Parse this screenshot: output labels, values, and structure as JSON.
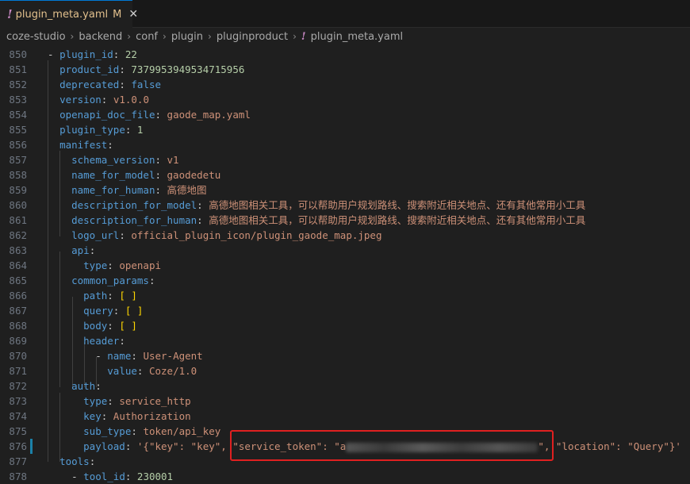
{
  "tab": {
    "icon": "exclamation-icon",
    "excl": "!",
    "filename": "plugin_meta.yaml",
    "modified": "M",
    "close": "✕"
  },
  "breadcrumb": {
    "segments": [
      "coze-studio",
      "backend",
      "conf",
      "plugin",
      "pluginproduct"
    ],
    "file_excl": "!",
    "file": "plugin_meta.yaml"
  },
  "editor": {
    "line_numbers": [
      "850",
      "851",
      "852",
      "853",
      "854",
      "855",
      "856",
      "857",
      "858",
      "859",
      "860",
      "861",
      "862",
      "863",
      "864",
      "865",
      "866",
      "867",
      "868",
      "869",
      "870",
      "871",
      "872",
      "873",
      "874",
      "875",
      "876",
      "877",
      "878"
    ],
    "lines": {
      "l850": {
        "key": "plugin_id",
        "value": "22"
      },
      "l851": {
        "key": "product_id",
        "value": "7379953949534715956"
      },
      "l852": {
        "key": "deprecated",
        "value": "false"
      },
      "l853": {
        "key": "version",
        "value": "v1.0.0"
      },
      "l854": {
        "key": "openapi_doc_file",
        "value": "gaode_map.yaml"
      },
      "l855": {
        "key": "plugin_type",
        "value": "1"
      },
      "l856": {
        "key": "manifest"
      },
      "l857": {
        "key": "schema_version",
        "value": "v1"
      },
      "l858": {
        "key": "name_for_model",
        "value": "gaodedetu"
      },
      "l859": {
        "key": "name_for_human",
        "value": "高德地图"
      },
      "l860": {
        "key": "description_for_model",
        "value": "高德地图相关工具，可以帮助用户规划路线、搜索附近相关地点、还有其他常用小工具"
      },
      "l861": {
        "key": "description_for_human",
        "value": "高德地图相关工具，可以帮助用户规划路线、搜索附近相关地点、还有其他常用小工具"
      },
      "l862": {
        "key": "logo_url",
        "value": "official_plugin_icon/plugin_gaode_map.jpeg"
      },
      "l863": {
        "key": "api"
      },
      "l864": {
        "key": "type",
        "value": "openapi"
      },
      "l865": {
        "key": "common_params"
      },
      "l866": {
        "key": "path",
        "value": "[ ]"
      },
      "l867": {
        "key": "query",
        "value": "[ ]"
      },
      "l868": {
        "key": "body",
        "value": "[ ]"
      },
      "l869": {
        "key": "header"
      },
      "l870": {
        "key": "name",
        "value": "User-Agent"
      },
      "l871": {
        "key": "value",
        "value": "Coze/1.0"
      },
      "l872": {
        "key": "auth"
      },
      "l873": {
        "key": "type",
        "value": "service_http"
      },
      "l874": {
        "key": "key",
        "value": "Authorization"
      },
      "l875": {
        "key": "sub_type",
        "value": "token/api_key"
      },
      "l876": {
        "key": "payload",
        "value_start": "'{\"key\": \"key\", \"service_token\": \"a",
        "value_end": "\", \"location\": \"Query\"}'"
      },
      "l877": {
        "key": "tools"
      },
      "l878": {
        "key": "tool_id",
        "value": "230001"
      }
    }
  },
  "colors": {
    "key": "#569cd6",
    "string": "#ce9178",
    "number": "#b5cea8",
    "highlight_box": "#e02020",
    "tab_modified": "#e2c08d"
  }
}
